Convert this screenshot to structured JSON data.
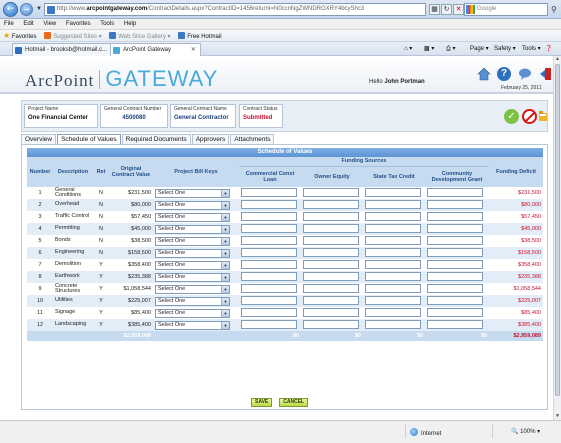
{
  "browser": {
    "url_prefix": "http://www.",
    "url_domain": "arcpointgateway.com",
    "url_rest": "/ContractDetails.aspx?ContractID=1456returnI=N0ccnNgZWNDRGXRY4bcyShc3",
    "search_placeholder": "Google",
    "menu": [
      "File",
      "Edit",
      "View",
      "Favorites",
      "Tools",
      "Help"
    ],
    "favorites_label": "Favorites",
    "fav_items": [
      "Suggested Sites ▾",
      "Web Slice Gallery ▾",
      "Free Hotmail"
    ],
    "tabs": [
      {
        "label": "Hotmail - brooksb@hotmail.c..."
      },
      {
        "label": "ArcPoint Gateway"
      }
    ],
    "commands": [
      "Page ▾",
      "Safety ▾",
      "Tools ▾"
    ],
    "status_zone": "Internet",
    "zoom": "100%"
  },
  "header": {
    "logo_arc": "ArcPoint",
    "logo_gateway": "GATEWAY",
    "hello_prefix": "Hello",
    "user_name": "John Portman",
    "date": "February 25, 2011"
  },
  "project": {
    "project_name_label": "Project Name",
    "project_name": "One Financial Center",
    "gc_number_label": "General Contract Number",
    "gc_number": "4500080",
    "gc_name_label": "General Contract Name",
    "gc_name": "General Contractor",
    "status_label": "Contract Status",
    "status": "Submitted"
  },
  "page_tabs": [
    "Overview",
    "Schedule of Values",
    "Required Documents",
    "Approvers",
    "Attachments"
  ],
  "sov": {
    "title": "Schedule of Values",
    "funding_sources_label": "Funding Sources",
    "headers": {
      "number": "Number",
      "description": "Description",
      "ret": "Ret",
      "original": "Original Contract Value",
      "bill_keys": "Project Bill Keys",
      "commercial": "Commercial Const Loan",
      "owner": "Owner Equity",
      "state": "State Tax Credit",
      "community": "Community Development Grant",
      "deficit": "Funding Deficit"
    },
    "select_default": "Select One",
    "rows": [
      {
        "n": "1",
        "desc": "General Conditions",
        "ret": "N",
        "value": "$231,500",
        "deficit": "$231,500"
      },
      {
        "n": "2",
        "desc": "Overhead",
        "ret": "N",
        "value": "$80,000",
        "deficit": "$80,000"
      },
      {
        "n": "3",
        "desc": "Traffic Control",
        "ret": "N",
        "value": "$57,450",
        "deficit": "$57,450"
      },
      {
        "n": "4",
        "desc": "Permitting",
        "ret": "N",
        "value": "$45,000",
        "deficit": "$45,000"
      },
      {
        "n": "5",
        "desc": "Bonds",
        "ret": "N",
        "value": "$38,500",
        "deficit": "$38,500"
      },
      {
        "n": "6",
        "desc": "Engineering",
        "ret": "N",
        "value": "$158,500",
        "deficit": "$158,500"
      },
      {
        "n": "7",
        "desc": "Demolition",
        "ret": "Y",
        "value": "$358,400",
        "deficit": "$358,400"
      },
      {
        "n": "8",
        "desc": "Earthwork",
        "ret": "Y",
        "value": "$235,388",
        "deficit": "$235,388"
      },
      {
        "n": "9",
        "desc": "Concrete Structures",
        "ret": "Y",
        "value": "$1,058,544",
        "deficit": "$1,058,544"
      },
      {
        "n": "10",
        "desc": "Utilities",
        "ret": "Y",
        "value": "$225,007",
        "deficit": "$225,007"
      },
      {
        "n": "11",
        "desc": "Signage",
        "ret": "Y",
        "value": "$85,400",
        "deficit": "$85,400"
      },
      {
        "n": "12",
        "desc": "Landscaping",
        "ret": "Y",
        "value": "$385,400",
        "deficit": "$385,400"
      }
    ],
    "totals": {
      "value": "$2,959,089",
      "commercial": "$0",
      "owner": "$0",
      "state": "$0",
      "community": "$0",
      "deficit": "$2,959,089"
    }
  },
  "buttons": {
    "save": "SAVE",
    "cancel": "CANCEL"
  },
  "colors": {
    "accent": "#4aa9d8",
    "header_blue": "#5c93d3",
    "deficit_red": "#c8102e",
    "button_green": "#b9d94a"
  }
}
